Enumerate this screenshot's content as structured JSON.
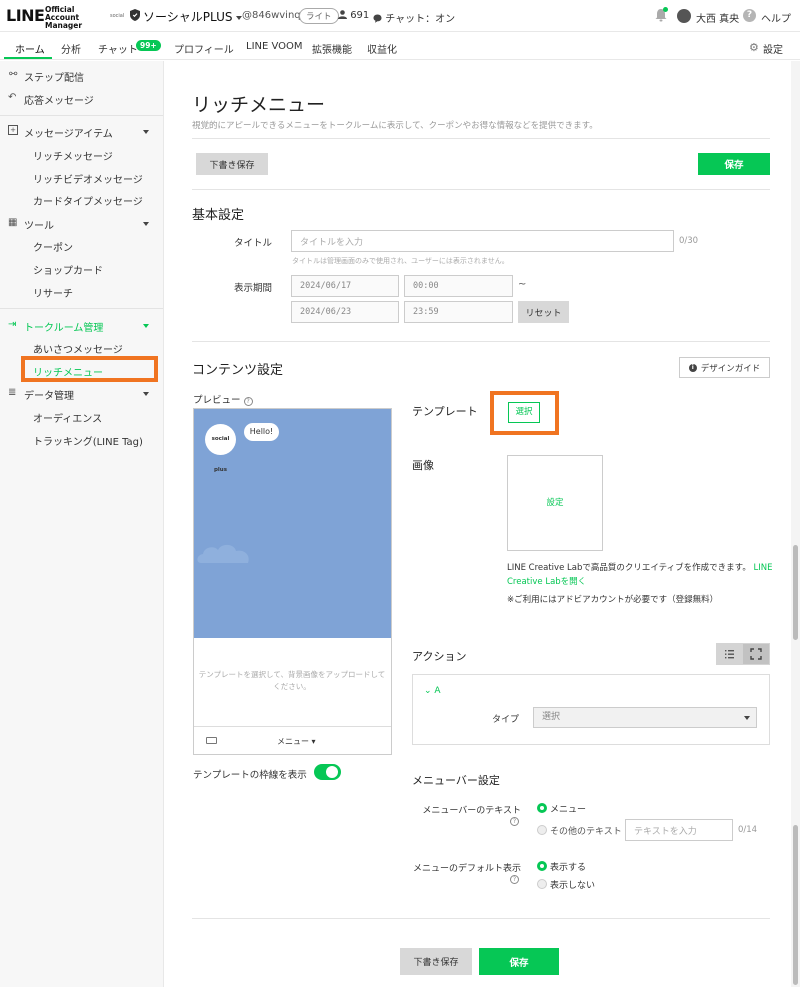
{
  "topbar": {
    "logo": "LINE",
    "logo_sub": "Official Account Manager",
    "account_tag": "social",
    "account_name": "ソーシャルPLUS",
    "account_id": "@846wvinq",
    "plan": "ライト",
    "friends": "691",
    "chat_status": "チャット：オン",
    "user_name": "大西 真央",
    "help": "ヘルプ",
    "help_glyph": "?"
  },
  "nav": {
    "items": [
      "ホーム",
      "分析",
      "チャット",
      "プロフィール",
      "LINE VOOM",
      "拡張機能",
      "収益化"
    ],
    "chat_badge": "99+",
    "settings": "設定"
  },
  "sidebar": {
    "step": "ステップ配信",
    "auto_reply": "応答メッセージ",
    "message_items": "メッセージアイテム",
    "rich_message": "リッチメッセージ",
    "rich_video": "リッチビデオメッセージ",
    "card_type": "カードタイプメッセージ",
    "tools": "ツール",
    "coupon": "クーポン",
    "shop_card": "ショップカード",
    "research": "リサーチ",
    "talk_room": "トークルーム管理",
    "greeting": "あいさつメッセージ",
    "rich_menu": "リッチメニュー",
    "data": "データ管理",
    "audience": "オーディエンス",
    "tracking": "トラッキング(LINE Tag)"
  },
  "page": {
    "title": "リッチメニュー",
    "description": "視覚的にアピールできるメニューをトークルームに表示して、クーポンやお得な情報などを提供できます。",
    "draft_save": "下書き保存",
    "save": "保存"
  },
  "basic": {
    "title": "基本設定",
    "title_label": "タイトル",
    "title_placeholder": "タイトルを入力",
    "title_counter": "0/30",
    "title_hint": "タイトルは管理画面のみで使用され、ユーザーには表示されません。",
    "period_label": "表示期間",
    "start_date": "2024/06/17",
    "start_time": "00:00",
    "tilde": "~",
    "end_date": "2024/06/23",
    "end_time": "23:59",
    "reset": "リセット"
  },
  "content": {
    "title": "コンテンツ設定",
    "design_guide": "デザインガイド",
    "info_glyph": "i",
    "preview_label": "プレビュー",
    "preview_logo": "social plus",
    "preview_bubble": "Hello!",
    "preview_msg": "テンプレートを選択して、背景画像をアップロードしてください。",
    "menu_label": "メニュー",
    "menu_caret": "▾",
    "template_frame": "テンプレートの枠線を表示",
    "template_label": "テンプレート",
    "template_select": "選択",
    "image_label": "画像",
    "image_set": "設定",
    "clab_text": "LINE Creative Labで高品質のクリエイティブを作成できます。",
    "clab_link": "LINE Creative Labを開く",
    "note": "※ご利用にはアドビアカウントが必要です（登録無料）",
    "action_label": "アクション",
    "action_a": "A",
    "action_caret": "⌄",
    "type_label": "タイプ",
    "type_placeholder": "選択",
    "menubar_title": "メニューバー設定",
    "menubar_text_label": "メニューバーのテキスト",
    "opt_menu": "メニュー",
    "opt_other": "その他のテキスト",
    "text_placeholder": "テキストを入力",
    "text_counter": "0/14",
    "default_label": "メニューのデフォルト表示",
    "opt_show": "表示する",
    "opt_hide": "表示しない",
    "qmark_glyph": "?"
  },
  "colors": {
    "accent": "#06c755",
    "highlight": "#f07421",
    "preview_bg": "#7fa3d6"
  }
}
